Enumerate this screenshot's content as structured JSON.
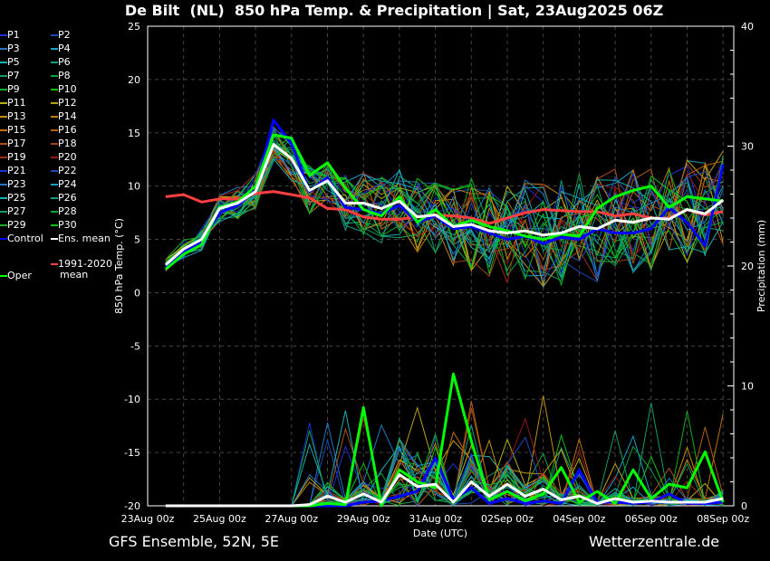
{
  "title": "De Bilt  (NL)  850 hPa Temp. & Precipitation | Sat, 23Aug2025 06Z",
  "footer": {
    "model": "GFS Ensemble, 52N, 5E",
    "site": "Wetterzentrale.de"
  },
  "legend": {
    "members": [
      {
        "label": "P1",
        "color": "#1a30d8"
      },
      {
        "label": "P2",
        "color": "#1a4ab8"
      },
      {
        "label": "P3",
        "color": "#1f78c0"
      },
      {
        "label": "P4",
        "color": "#17a0c8"
      },
      {
        "label": "P5",
        "color": "#17b0b4"
      },
      {
        "label": "P6",
        "color": "#12a084"
      },
      {
        "label": "P7",
        "color": "#10a064"
      },
      {
        "label": "P8",
        "color": "#10a044"
      },
      {
        "label": "P9",
        "color": "#10b024"
      },
      {
        "label": "P10",
        "color": "#10c010"
      },
      {
        "label": "P11",
        "color": "#b8b010"
      },
      {
        "label": "P12",
        "color": "#c0a010"
      },
      {
        "label": "P13",
        "color": "#c09010"
      },
      {
        "label": "P14",
        "color": "#c08010"
      },
      {
        "label": "P15",
        "color": "#c07010"
      },
      {
        "label": "P16",
        "color": "#b06010"
      },
      {
        "label": "P17",
        "color": "#b05018"
      },
      {
        "label": "P18",
        "color": "#a84018"
      },
      {
        "label": "P19",
        "color": "#a02818"
      },
      {
        "label": "P20",
        "color": "#901818"
      },
      {
        "label": "P21",
        "color": "#1a30d8"
      },
      {
        "label": "P22",
        "color": "#1a4ab8"
      },
      {
        "label": "P23",
        "color": "#1f78c0"
      },
      {
        "label": "P24",
        "color": "#17a0c8"
      },
      {
        "label": "P25",
        "color": "#17b0b4"
      },
      {
        "label": "P26",
        "color": "#12a084"
      },
      {
        "label": "P27",
        "color": "#10a064"
      },
      {
        "label": "P28",
        "color": "#10a044"
      },
      {
        "label": "P29",
        "color": "#10b024"
      },
      {
        "label": "P30",
        "color": "#10c010"
      }
    ],
    "control": {
      "label": "Control",
      "color": "#0000ff"
    },
    "ens_mean": {
      "label": "Ens. mean",
      "color": "#ffffff"
    },
    "climate": {
      "label_line1": "1991-2020",
      "label_line2": "mean",
      "color": "#ff4040"
    },
    "oper": {
      "label": "Oper",
      "color": "#00ff00"
    }
  },
  "chart_data": {
    "type": "line",
    "title": "De Bilt  (NL)  850 hPa Temp. & Precipitation | Sat, 23Aug2025 06Z",
    "xlabel": "Date (UTC)",
    "ylabel": "850 hPa Temp. (°C)",
    "y2label": "Precipitation (mm)",
    "xlim": [
      "23Aug 00z",
      "08Sep 07z"
    ],
    "ylim": [
      -20,
      25
    ],
    "y2lim": [
      0,
      40
    ],
    "grid": true,
    "legend_position": "left-outside",
    "x_ticks": [
      "23Aug 00z",
      "25Aug 00z",
      "27Aug 00z",
      "29Aug 00z",
      "31Aug 00z",
      "02Sep 00z",
      "04Sep 00z",
      "06Sep 00z",
      "08Sep 00z"
    ],
    "y_ticks": [
      25,
      20,
      15,
      10,
      5,
      0,
      -5,
      -10,
      -15,
      -20
    ],
    "y2_ticks": [
      40,
      30,
      20,
      10,
      0
    ],
    "x_times": [
      "23Aug 12z",
      "24Aug 00z",
      "24Aug 12z",
      "25Aug 00z",
      "25Aug 12z",
      "26Aug 00z",
      "26Aug 12z",
      "27Aug 00z",
      "27Aug 12z",
      "28Aug 00z",
      "28Aug 12z",
      "29Aug 00z",
      "29Aug 12z",
      "30Aug 00z",
      "30Aug 12z",
      "31Aug 00z",
      "31Aug 12z",
      "01Sep 00z",
      "01Sep 12z",
      "02Sep 00z",
      "02Sep 12z",
      "03Sep 00z",
      "03Sep 12z",
      "04Sep 00z",
      "04Sep 12z",
      "05Sep 00z",
      "05Sep 12z",
      "06Sep 00z",
      "06Sep 12z",
      "07Sep 00z",
      "07Sep 12z",
      "08Sep 00z"
    ],
    "temperature": {
      "ens_mean": [
        2.6,
        4.1,
        5.0,
        7.9,
        8.4,
        9.5,
        13.9,
        12.6,
        9.6,
        10.5,
        8.4,
        8.4,
        7.9,
        8.6,
        7.1,
        7.3,
        6.2,
        6.4,
        5.8,
        5.6,
        5.8,
        5.4,
        5.6,
        6.2,
        6.0,
        6.8,
        6.6,
        7.0,
        6.9,
        7.8,
        7.4,
        8.7
      ],
      "control": [
        2.4,
        3.8,
        4.8,
        7.5,
        8.2,
        9.6,
        16.2,
        14.0,
        9.5,
        10.8,
        8.0,
        7.8,
        7.4,
        8.2,
        6.6,
        7.2,
        6.0,
        6.2,
        5.6,
        5.0,
        5.3,
        4.6,
        5.2,
        5.0,
        6.0,
        5.6,
        5.6,
        6.0,
        8.0,
        6.6,
        4.4,
        12.0
      ],
      "oper": [
        2.2,
        3.6,
        4.5,
        8.0,
        8.5,
        10.0,
        14.8,
        14.5,
        11.0,
        12.2,
        9.8,
        7.8,
        7.2,
        9.0,
        6.6,
        7.8,
        6.2,
        6.8,
        6.2,
        5.8,
        5.3,
        5.0,
        5.5,
        5.3,
        7.9,
        9.0,
        9.6,
        10.0,
        8.0,
        9.0,
        8.8,
        8.6
      ],
      "climate_1991_2020": [
        9.0,
        9.2,
        8.5,
        8.8,
        8.8,
        9.3,
        9.5,
        9.2,
        8.9,
        7.9,
        7.8,
        7.1,
        6.9,
        6.9,
        7.1,
        7.3,
        7.2,
        7.0,
        6.5,
        7.0,
        7.5,
        7.8,
        7.7,
        7.6,
        7.6,
        7.2,
        7.4,
        7.0,
        7.0,
        7.8,
        7.3,
        7.6
      ]
    },
    "precipitation_mm": {
      "ens_mean": [
        0,
        0,
        0,
        0,
        0,
        0,
        0,
        0,
        0.1,
        0.8,
        0.3,
        1.0,
        0.3,
        2.6,
        1.6,
        1.8,
        0.3,
        2.0,
        0.8,
        1.8,
        0.8,
        1.4,
        0.5,
        0.8,
        0.2,
        0.6,
        0.3,
        0.4,
        0.3,
        0.3,
        0.3,
        0.6
      ],
      "control": [
        0,
        0,
        0,
        0,
        0,
        0,
        0,
        0,
        0,
        0,
        0,
        0.3,
        0.4,
        0.8,
        1.2,
        4.0,
        0.5,
        1.5,
        0.2,
        0.6,
        0.2,
        0.4,
        0.2,
        3.0,
        0.3,
        0.3,
        0.2,
        0.3,
        1.0,
        0.2,
        0.2,
        0.3
      ],
      "oper": [
        0,
        0,
        0,
        0,
        0,
        0,
        0,
        0,
        0,
        0.2,
        0.1,
        8.2,
        0,
        3.0,
        2.0,
        1.5,
        11.0,
        5.4,
        0.5,
        1.2,
        0.4,
        1.0,
        3.2,
        0.3,
        1.2,
        0.2,
        3.0,
        0.6,
        1.8,
        1.5,
        4.5,
        0.3
      ]
    }
  }
}
